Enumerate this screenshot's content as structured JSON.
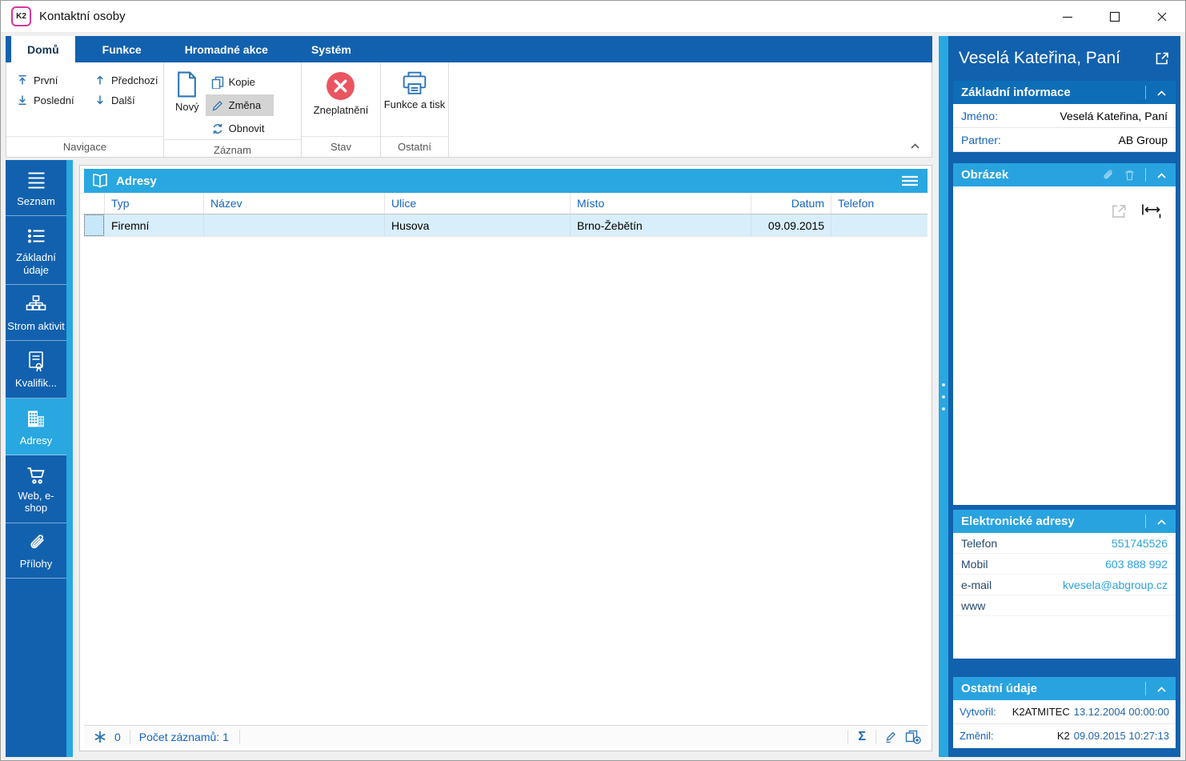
{
  "window": {
    "title": "Kontaktní osoby",
    "logo_text": "K2"
  },
  "tabs": [
    {
      "label": "Domů",
      "active": true
    },
    {
      "label": "Funkce",
      "active": false
    },
    {
      "label": "Hromadné akce",
      "active": false
    },
    {
      "label": "Systém",
      "active": false
    }
  ],
  "ribbon": {
    "navigace": {
      "label": "Navigace",
      "first": "První",
      "prev": "Předchozí",
      "last": "Poslední",
      "next": "Další"
    },
    "zaznam": {
      "label": "Záznam",
      "new": "Nový",
      "copy": "Kopie",
      "change": "Změna",
      "refresh": "Obnovit"
    },
    "stav": {
      "label": "Stav",
      "invalidate": "Zneplatnění"
    },
    "ostatni": {
      "label": "Ostatní",
      "print": "Funkce a tisk"
    }
  },
  "sidebar": {
    "items": [
      {
        "label": "Seznam",
        "active": false
      },
      {
        "label": "Základní údaje",
        "active": false
      },
      {
        "label": "Strom aktivit",
        "active": false
      },
      {
        "label": "Kvalifik...",
        "active": false
      },
      {
        "label": "Adresy",
        "active": true
      },
      {
        "label": "Web, e-shop",
        "active": false
      },
      {
        "label": "Přílohy",
        "active": false
      }
    ]
  },
  "table": {
    "title": "Adresy",
    "columns": [
      "Typ",
      "Název",
      "Ulice",
      "Místo",
      "Datum",
      "Telefon"
    ],
    "rows": [
      {
        "typ": "Firemní",
        "nazev": "",
        "ulice": "Husova",
        "misto": "Brno-Žebětín",
        "datum": "09.09.2015",
        "telefon": ""
      }
    ]
  },
  "statusbar": {
    "counter": "0",
    "records": "Počet záznamů: 1",
    "sum_symbol": "Σ"
  },
  "panel": {
    "title": "Veselá Kateřina, Paní",
    "zakladni": {
      "title": "Základní informace",
      "rows": [
        {
          "label": "Jméno:",
          "value": "Veselá Kateřina, Paní"
        },
        {
          "label": "Partner:",
          "value": "AB Group"
        }
      ]
    },
    "obrazek": {
      "title": "Obrázek"
    },
    "elektronicke": {
      "title": "Elektronické adresy",
      "rows": [
        {
          "label": "Telefon",
          "value": "551745526"
        },
        {
          "label": "Mobil",
          "value": "603 888 992"
        },
        {
          "label": "e-mail",
          "value": "kvesela@abgroup.cz"
        },
        {
          "label": "www",
          "value": ""
        }
      ]
    },
    "ostatni": {
      "title": "Ostatní údaje",
      "rows": [
        {
          "label": "Vytvořil:",
          "user": "K2ATMITEC",
          "datetime": "13.12.2004 00:00:00"
        },
        {
          "label": "Změnil:",
          "user": "K2",
          "datetime": "09.09.2015 10:27:13"
        }
      ]
    }
  },
  "colors": {
    "primary_blue": "#1261AE",
    "accent_cyan": "#29A7E0",
    "link_blue": "#1565C0",
    "invalid_red": "#EA5560",
    "selected_row": "#D9EEFB",
    "selected_button_bg": "#D4D4D4"
  }
}
